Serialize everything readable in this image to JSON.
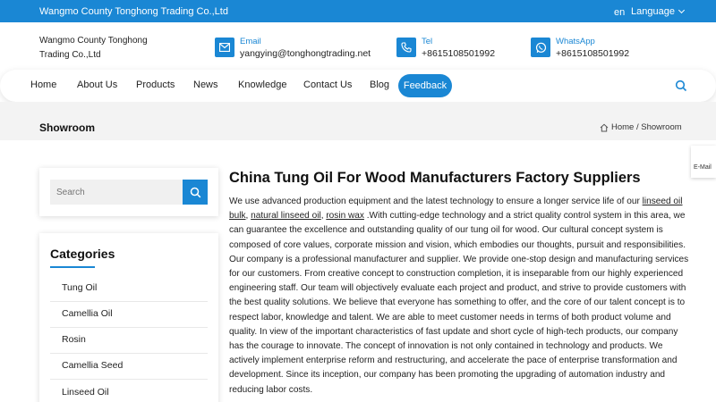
{
  "topbar": {
    "company": "Wangmo County Tonghong Trading Co.,Ltd",
    "lang_code": "en",
    "language": "Language"
  },
  "header": {
    "brand_line1": "Wangmo County Tonghong",
    "brand_line2": "Trading Co.,Ltd",
    "email_label": "Email",
    "email_value": "yangying@tonghongtrading.net",
    "tel_label": "Tel",
    "tel_value": "+8615108501992",
    "whatsapp_label": "WhatsApp",
    "whatsapp_value": "+8615108501992"
  },
  "nav": {
    "home": "Home",
    "about": "About Us",
    "products": "Products",
    "news": "News",
    "knowledge": "Knowledge",
    "contact": "Contact Us",
    "blog": "Blog",
    "feedback": "Feedback"
  },
  "band": {
    "title": "Showroom",
    "breadcrumb": "Home / Showroom"
  },
  "side_tab": {
    "label": "E-Mail"
  },
  "search": {
    "placeholder": "Search"
  },
  "categories": {
    "heading": "Categories",
    "items": [
      "Tung Oil",
      "Camellia Oil",
      "Rosin",
      "Camellia Seed",
      "Linseed Oil"
    ]
  },
  "article": {
    "title": "China Tung Oil For Wood Manufacturers Factory Suppliers",
    "p1_start": "We use advanced production equipment and the latest technology to ensure a longer service life of our ",
    "link1": "linseed oil bulk",
    "comma1": ", ",
    "link2": "natural linseed oil",
    "comma2": ", ",
    "link3": "rosin wax",
    "p1_end": " .With cutting-edge technology and a strict quality control system in this area, we can guarantee the excellence and outstanding quality of our tung oil for wood. Our cultural concept system is composed of core values, corporate mission and vision, which embodies our thoughts, pursuit and responsibilities. Our company is a professional manufacturer and supplier. We provide one-stop design and manufacturing services for our customers. From creative concept to construction completion, it is inseparable from our highly experienced engineering staff. Our team will objectively evaluate each project and product, and strive to provide customers with the best quality solutions. We believe that everyone has something to offer, and the core of our talent concept is to respect labor, knowledge and talent. We are able to meet customer needs in terms of both product volume and quality. In view of the important characteristics of fast update and short cycle of high-tech products, our company has the courage to innovate. The concept of innovation is not only contained in technology and products. We actively implement enterprise reform and restructuring, and accelerate the pace of enterprise transformation and development. Since its inception, our company has been promoting the upgrading of automation industry and reducing labor costs."
  },
  "colors": {
    "accent": "#1a87d4",
    "band": "#f3f3f3"
  }
}
